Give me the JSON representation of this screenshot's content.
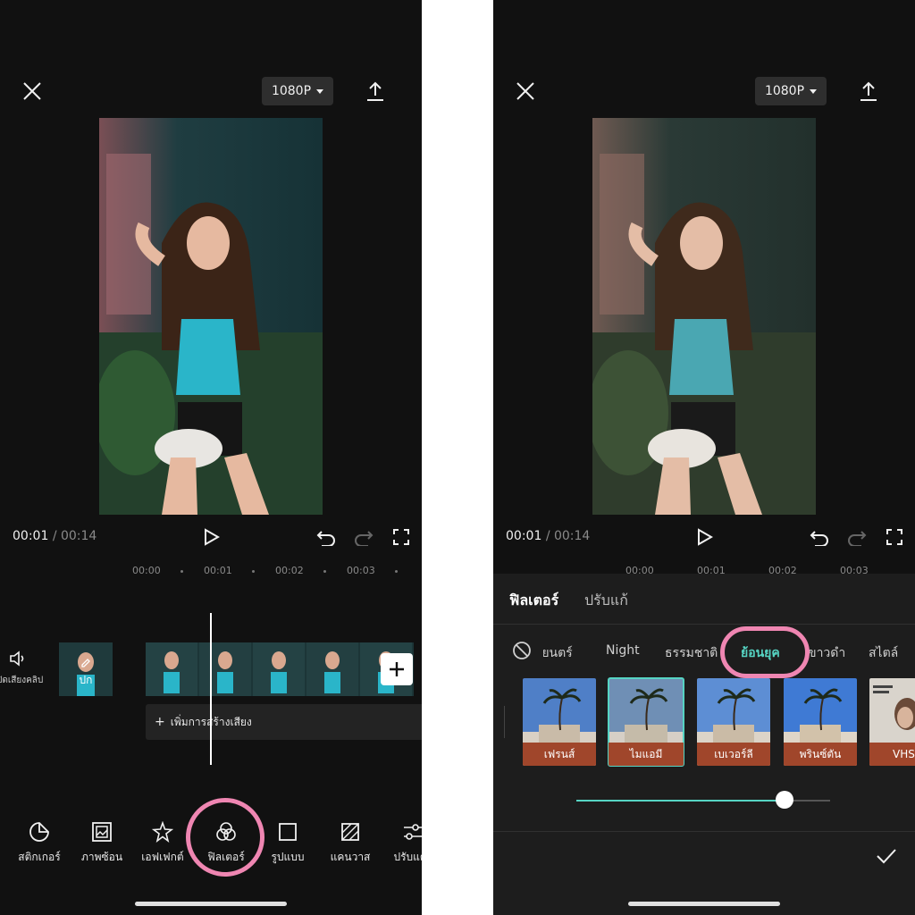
{
  "left": {
    "resolution": "1080P",
    "time_current": "00:01",
    "time_separator": "/",
    "time_total": "00:14",
    "ruler": [
      "00:00",
      "00:01",
      "00:02",
      "00:03"
    ],
    "audio_label": "ปิดเสียงคลิป",
    "cover_label": "ปก",
    "add_audio_label": "เพิ่มการสร้างเสียง",
    "tools": [
      "สติกเกอร์",
      "ภาพซ้อน",
      "เอฟเฟกต์",
      "ฟิลเตอร์",
      "รูปแบบ",
      "แคนวาส",
      "ปรับแต่ง"
    ]
  },
  "right": {
    "resolution": "1080P",
    "time_current": "00:01",
    "time_separator": "/",
    "time_total": "00:14",
    "ruler": [
      "00:00",
      "00:01",
      "00:02",
      "00:03"
    ],
    "tabs": [
      "ฟิลเตอร์",
      "ปรับแก้"
    ],
    "categories": [
      "ภาพยนตร์",
      "Night",
      "ธรรมชาติ",
      "ย้อนยุค",
      "ขาวดำ",
      "สไตล์"
    ],
    "filters": [
      "เฟรนส์",
      "ไมแอมี",
      "เบเวอร์ลี",
      "พรินซ์ตัน",
      "VHS"
    ],
    "intensity": 0.82
  },
  "colors": {
    "accent": "#56d4c3",
    "highlight_ring": "#ef86b2",
    "background": "#111111",
    "panel": "#1d1d1d"
  }
}
